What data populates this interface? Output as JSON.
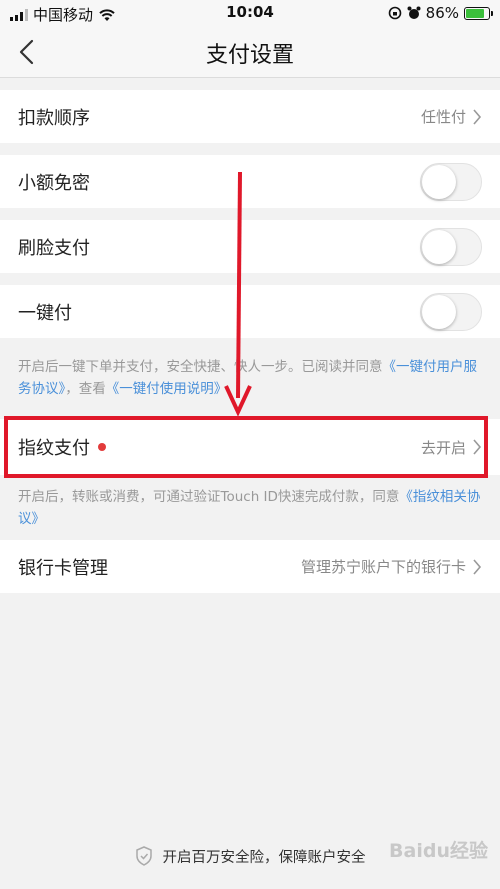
{
  "status_bar": {
    "carrier": "中国移动",
    "time": "10:04",
    "battery": "86%",
    "battery_level": 0.86
  },
  "nav": {
    "title": "支付设置"
  },
  "rows": {
    "deduction_order": {
      "label": "扣款顺序",
      "value": "任性付"
    },
    "small_no_pwd": {
      "label": "小额免密",
      "enabled": false
    },
    "face_pay": {
      "label": "刷脸支付",
      "enabled": false
    },
    "one_click": {
      "label": "一键付",
      "enabled": false
    },
    "fingerprint": {
      "label": "指纹支付",
      "value": "去开启"
    },
    "bank_card": {
      "label": "银行卡管理",
      "value": "管理苏宁账户下的银行卡"
    }
  },
  "notes": {
    "one_click_text": "开启后一键下单并支付，安全快捷、快人一步。已阅读并同意",
    "one_click_link1": "《一键付用户服务协议》",
    "one_click_mid": "，查看",
    "one_click_link2": "《一键付使用说明》",
    "fingerprint_text": "开启后，转账或消费，可通过验证Touch ID快速完成付款，同意",
    "fingerprint_link": "《指纹相关协议》"
  },
  "footer": {
    "text": "开启百万安全险，保障账户安全"
  },
  "watermark": "Baidu经验",
  "colors": {
    "annotation_red": "#e0182a",
    "link_blue": "#4a90d9",
    "dot_red": "#e23b3b",
    "battery_green": "#3bbf3b"
  }
}
